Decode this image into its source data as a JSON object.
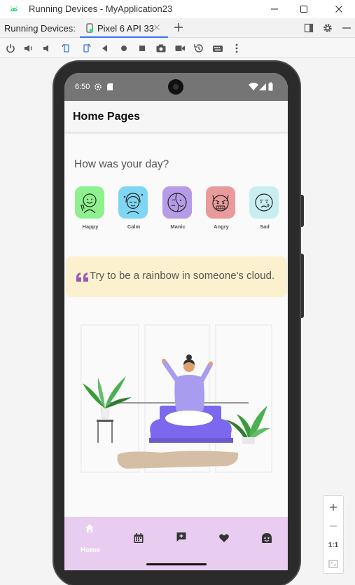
{
  "window": {
    "title": "Running Devices - MyApplication23",
    "app_icon": "android-icon",
    "controls": [
      "minimize-icon",
      "maximize-icon",
      "close-icon"
    ]
  },
  "tabbar": {
    "label": "Running Devices:",
    "tab_label": "Pixel 6 API 33",
    "tab_icon": "device-icon",
    "right_icons": [
      "layout-icon",
      "gear-icon",
      "minus-icon"
    ]
  },
  "toolbar": {
    "icons": [
      "power-icon",
      "volume-up-icon",
      "volume-down-icon",
      "rotate-left-icon",
      "rotate-right-icon",
      "back-icon",
      "home-icon",
      "overview-icon",
      "screenshot-icon",
      "screen-record-icon",
      "snapshot-icon",
      "keyboard-icon",
      "more-icon"
    ]
  },
  "device": {
    "status_time": "6:50",
    "appbar_title": "Home Pages",
    "question": "How was your day?",
    "moods": [
      {
        "label": "Happy",
        "color": "#8ef08e",
        "icon": "happy-face-icon"
      },
      {
        "label": "Calm",
        "color": "#7fd6f2",
        "icon": "calm-face-icon"
      },
      {
        "label": "Manic",
        "color": "#b69be6",
        "icon": "manic-face-icon"
      },
      {
        "label": "Angry",
        "color": "#e99a9a",
        "icon": "angry-face-icon"
      },
      {
        "label": "Sad",
        "color": "#c8eef2",
        "icon": "sad-face-icon"
      }
    ],
    "quote": "Try to be a rainbow in someone's cloud.",
    "quote_card_color": "#fbf1cf",
    "bottom_nav": {
      "background": "#e8cdf0",
      "items": [
        {
          "icon": "home-icon",
          "label": "Home"
        },
        {
          "icon": "calendar-icon",
          "label": ""
        },
        {
          "icon": "chat-plus-icon",
          "label": ""
        },
        {
          "icon": "heart-icon",
          "label": ""
        },
        {
          "icon": "mood-face-icon",
          "label": ""
        }
      ]
    }
  },
  "zoom": {
    "actual_size_label": "1:1",
    "icons": [
      "zoom-in-icon",
      "zoom-out-icon",
      "fit-screen-icon"
    ]
  }
}
